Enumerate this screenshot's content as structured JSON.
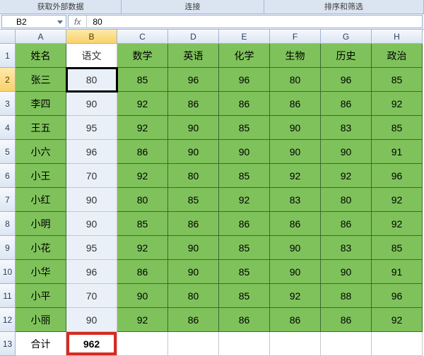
{
  "ribbon": {
    "group1": "获取外部数据",
    "group2": "连接",
    "group3": "排序和筛选"
  },
  "formula_bar": {
    "name_box": "B2",
    "fx_label": "fx",
    "value": "80"
  },
  "columns": [
    "A",
    "B",
    "C",
    "D",
    "E",
    "F",
    "G",
    "H"
  ],
  "row_numbers": [
    "1",
    "2",
    "3",
    "4",
    "5",
    "6",
    "7",
    "8",
    "9",
    "10",
    "11",
    "12",
    "13"
  ],
  "active_cell": {
    "row": 2,
    "col": "B"
  },
  "chart_data": {
    "type": "table",
    "headers": [
      "姓名",
      "语文",
      "数学",
      "英语",
      "化学",
      "生物",
      "历史",
      "政治"
    ],
    "rows": [
      [
        "张三",
        "80",
        "85",
        "96",
        "96",
        "80",
        "96",
        "85"
      ],
      [
        "李四",
        "90",
        "92",
        "86",
        "86",
        "86",
        "86",
        "92"
      ],
      [
        "王五",
        "95",
        "92",
        "90",
        "85",
        "90",
        "83",
        "85"
      ],
      [
        "小六",
        "96",
        "86",
        "90",
        "90",
        "90",
        "90",
        "91"
      ],
      [
        "小王",
        "70",
        "92",
        "80",
        "85",
        "92",
        "92",
        "96"
      ],
      [
        "小红",
        "90",
        "80",
        "85",
        "92",
        "83",
        "80",
        "92"
      ],
      [
        "小明",
        "90",
        "85",
        "86",
        "86",
        "86",
        "86",
        "92"
      ],
      [
        "小花",
        "95",
        "92",
        "90",
        "85",
        "90",
        "83",
        "85"
      ],
      [
        "小华",
        "96",
        "86",
        "90",
        "85",
        "90",
        "90",
        "91"
      ],
      [
        "小平",
        "70",
        "90",
        "80",
        "85",
        "92",
        "88",
        "96"
      ],
      [
        "小丽",
        "90",
        "92",
        "86",
        "86",
        "86",
        "86",
        "92"
      ]
    ],
    "total_row": [
      "合计",
      "962",
      "",
      "",
      "",
      "",
      "",
      ""
    ]
  }
}
